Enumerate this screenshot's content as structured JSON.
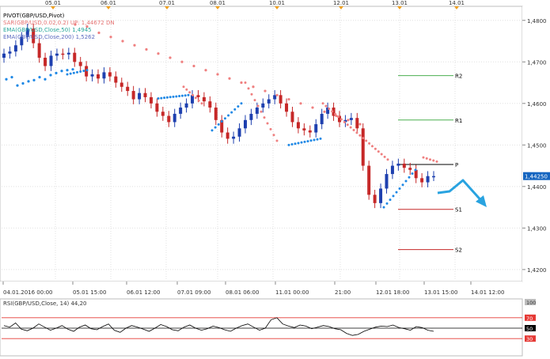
{
  "legend": {
    "pivot": "PIVOT(GBP/USD,Pivot)",
    "sar_prefix": "SAR(GBP/USD,0.02,0.2)",
    "sar_value": "UP: 1,44672 DN",
    "ema50": "EMA(GBP/USD,Close,50)   1,4945",
    "ema200": "EMA(GBP/USD,Close,200)   1,5262"
  },
  "top_dates": [
    "05.01",
    "06.01",
    "07.01",
    "08.01",
    "10.01",
    "12.01",
    "13.01",
    "14.01"
  ],
  "bottom_dates": [
    "04.01.2016 00:00",
    "05.01 15:00",
    "06.01 12:00",
    "07.01 09:00",
    "08.01 06:00",
    "11.01 00:00",
    "21:00",
    "12.01 18:00",
    "13.01 15:00",
    "14.01 12:00"
  ],
  "price_ticks": [
    "1,4800",
    "1,4700",
    "1,4600",
    "1,4500",
    "1,4400",
    "1,4300",
    "1,4200"
  ],
  "current_price": "1,44250",
  "pivot_levels": [
    {
      "label": "R2",
      "value": 1.4667,
      "color": "#4caf50"
    },
    {
      "label": "R1",
      "value": 1.456,
      "color": "#4caf50"
    },
    {
      "label": "P",
      "value": 1.4453,
      "color": "#000000"
    },
    {
      "label": "S1",
      "value": 1.4345,
      "color": "#c62828"
    },
    {
      "label": "S2",
      "value": 1.4248,
      "color": "#c62828"
    }
  ],
  "rsi": {
    "label": "RSI(GBP/USD,Close, 14)  44,20",
    "levels": [
      "100",
      "70",
      "50",
      "30"
    ]
  },
  "chart_data": {
    "type": "candlestick",
    "symbol": "GBP/USD",
    "ylim": [
      1.4175,
      1.483
    ],
    "y_ticks": [
      1.48,
      1.47,
      1.46,
      1.45,
      1.44,
      1.43,
      1.42
    ],
    "close_series": [
      1.472,
      1.4725,
      1.474,
      1.476,
      1.478,
      1.4745,
      1.471,
      1.469,
      1.4715,
      1.472,
      1.4718,
      1.4722,
      1.47,
      1.469,
      1.4665,
      1.467,
      1.466,
      1.4675,
      1.4665,
      1.465,
      1.464,
      1.463,
      1.461,
      1.4625,
      1.4615,
      1.46,
      1.458,
      1.457,
      1.4555,
      1.4575,
      1.459,
      1.46,
      1.462,
      1.4615,
      1.4605,
      1.459,
      1.456,
      1.453,
      1.4515,
      1.452,
      1.454,
      1.456,
      1.4575,
      1.459,
      1.46,
      1.461,
      1.462,
      1.46,
      1.458,
      1.4555,
      1.454,
      1.4535,
      1.453,
      1.455,
      1.4575,
      1.459,
      1.457,
      1.4555,
      1.456,
      1.4565,
      1.454,
      1.445,
      1.438,
      1.436,
      1.4395,
      1.443,
      1.445,
      1.4455,
      1.4445,
      1.444,
      1.442,
      1.441,
      1.4425,
      1.4425
    ],
    "sar_above": [
      1.479,
      1.4785,
      1.477,
      1.476,
      1.475,
      1.474,
      1.473,
      1.472,
      1.471,
      1.47,
      1.469,
      1.468,
      1.467,
      1.466,
      1.465,
      1.464,
      1.463,
      1.462,
      1.461,
      1.46,
      1.459,
      1.458,
      1.457,
      1.456,
      1.455
    ],
    "sar_below": [
      1.47,
      1.4705,
      1.4685,
      1.469,
      1.4695,
      1.4698,
      1.4705,
      1.47,
      1.471,
      1.4715,
      1.472,
      1.4722,
      1.4724
    ],
    "rsi_values": [
      55,
      52,
      60,
      48,
      45,
      50,
      58,
      52,
      46,
      50,
      55,
      48,
      44,
      52,
      56,
      49,
      47,
      53,
      58,
      46,
      42,
      50,
      55,
      52,
      48,
      44,
      50,
      57,
      53,
      47,
      45,
      52,
      56,
      50,
      46,
      49,
      54,
      51,
      47,
      44,
      50,
      55,
      58,
      52,
      46,
      50,
      66,
      70,
      58,
      54,
      51,
      56,
      54,
      49,
      52,
      55,
      53,
      49,
      47,
      40,
      36,
      38,
      44,
      48,
      52,
      54,
      53,
      56,
      51,
      49,
      46,
      53,
      51,
      46,
      44
    ]
  }
}
